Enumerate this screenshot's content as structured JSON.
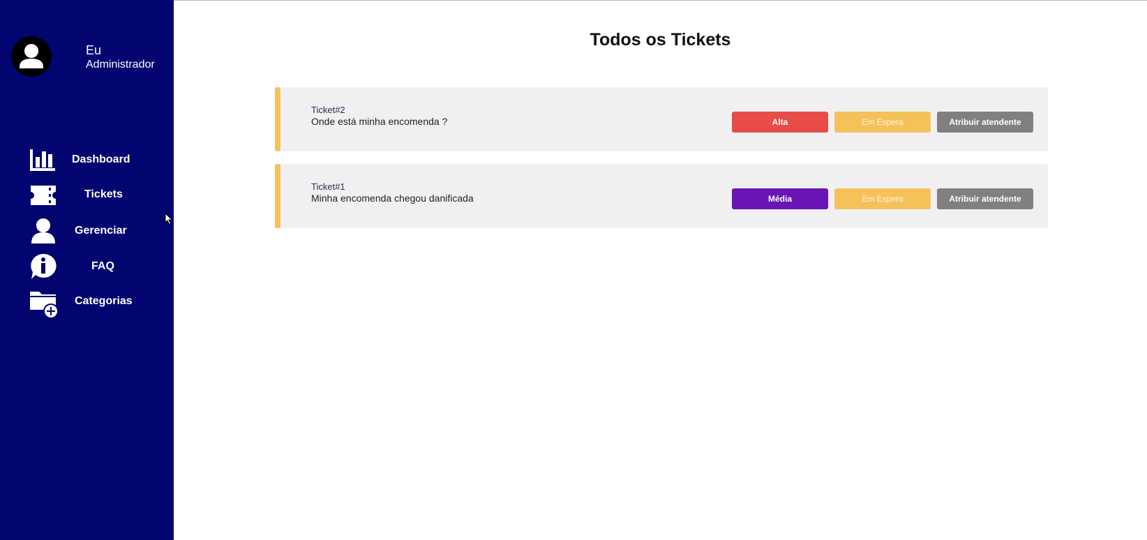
{
  "colors": {
    "sidebar_bg": "#02046f",
    "ticket_bg": "#f0f0f0",
    "ticket_accent": "#f5c25a",
    "priority_alta": "#e84c49",
    "priority_media": "#6a14b5",
    "status_waiting": "#f5c25a",
    "assign_button": "#808080"
  },
  "profile": {
    "name": "Eu",
    "role": "Administrador",
    "avatar_icon": "user-avatar-icon"
  },
  "sidebar": {
    "items": [
      {
        "label": "Dashboard",
        "icon": "bar-chart-icon"
      },
      {
        "label": "Tickets",
        "icon": "ticket-icon"
      },
      {
        "label": "Gerenciar",
        "icon": "person-icon"
      },
      {
        "label": "FAQ",
        "icon": "info-bubble-icon"
      },
      {
        "label": "Categorias",
        "icon": "folder-add-icon"
      }
    ]
  },
  "main": {
    "title": "Todos os Tickets",
    "tickets": [
      {
        "id": "Ticket#2",
        "description": "Onde está minha encomenda ?",
        "priority": "Alta",
        "priority_color": "#e84c49",
        "status": "Em Espera",
        "action": "Atribuir atendente"
      },
      {
        "id": "Ticket#1",
        "description": "Minha encomenda chegou danificada",
        "priority": "Média",
        "priority_color": "#6a14b5",
        "status": "Em Espera",
        "action": "Atribuir atendente"
      }
    ]
  }
}
